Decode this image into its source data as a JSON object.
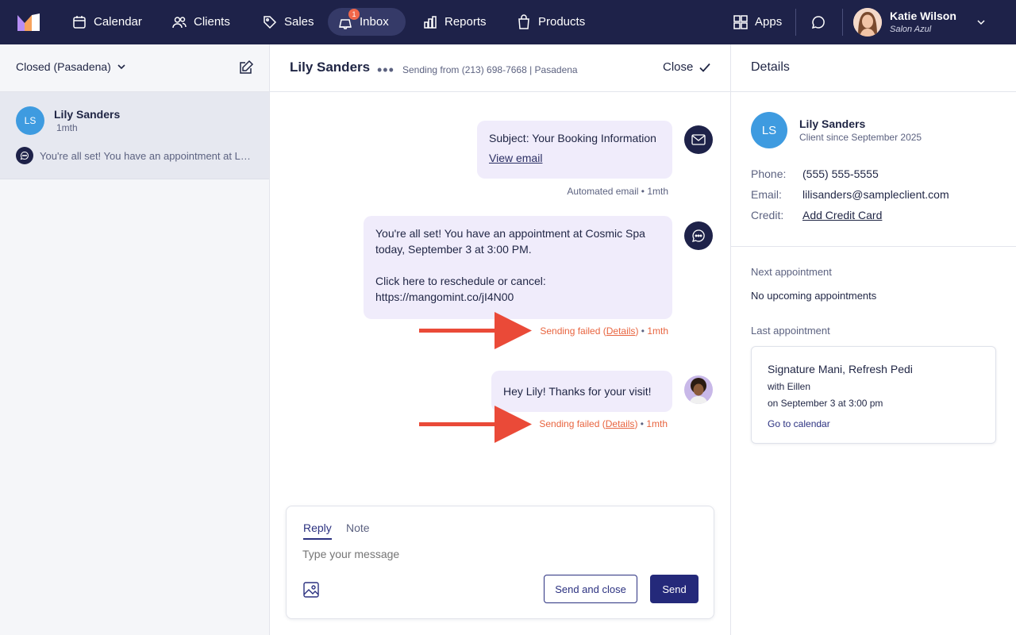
{
  "topnav": {
    "items": [
      {
        "label": "Calendar",
        "icon": "calendar-icon"
      },
      {
        "label": "Clients",
        "icon": "users-icon"
      },
      {
        "label": "Sales",
        "icon": "tag-icon"
      },
      {
        "label": "Inbox",
        "icon": "inbox-icon",
        "badge": "1",
        "active": true
      },
      {
        "label": "Reports",
        "icon": "bar-chart-icon"
      },
      {
        "label": "Products",
        "icon": "shopping-bag-icon"
      }
    ],
    "apps_label": "Apps",
    "user": {
      "name": "Katie Wilson",
      "location": "Salon Azul"
    }
  },
  "left_panel": {
    "filter_label": "Closed (Pasadena)",
    "conversations": [
      {
        "initials": "LS",
        "name": "Lily Sanders",
        "time": "1mth",
        "preview": "You're all set! You have an appointment at Lumiere..."
      }
    ]
  },
  "conversation": {
    "title": "Lily Sanders",
    "sending_from": "Sending from (213) 698-7668 | Pasadena",
    "close_label": "Close",
    "messages": [
      {
        "type": "email",
        "subject": "Subject: Your Booking Information",
        "link": "View email",
        "meta_source": "Automated email",
        "meta_time": "1mth"
      },
      {
        "type": "sms",
        "line1": "You're all set! You have an appointment at Cosmic Spa",
        "line2": "today, September 3 at 3:00 PM.",
        "line3": "Click here to reschedule or cancel:",
        "line4": "https://mangomint.co/jI4N00",
        "status": "Sending failed",
        "details": "Details",
        "meta_time": "1mth"
      },
      {
        "type": "staff",
        "text": "Hey Lily! Thanks for your visit!",
        "status": "Sending failed",
        "details": "Details",
        "meta_time": "1mth"
      }
    ],
    "composer": {
      "tab_reply": "Reply",
      "tab_note": "Note",
      "placeholder": "Type your message",
      "send_close_label": "Send and close",
      "send_label": "Send"
    }
  },
  "details": {
    "title": "Details",
    "client": {
      "initials": "LS",
      "name": "Lily Sanders",
      "since": "Client since September 2025"
    },
    "fields": {
      "phone_label": "Phone:",
      "phone": "(555) 555-5555",
      "email_label": "Email:",
      "email": "lilisanders@sampleclient.com",
      "credit_label": "Credit:",
      "credit_link": "Add Credit Card"
    },
    "next_label": "Next appointment",
    "next_text": "No upcoming appointments",
    "last_label": "Last appointment",
    "last_appt": {
      "title": "Signature Mani, Refresh Pedi",
      "with": "with Eillen",
      "when": "on September 3 at 3:00 pm",
      "link": "Go to calendar"
    }
  },
  "colors": {
    "nav_bg": "#1e2249",
    "accent": "#24297a",
    "error": "#e8643f",
    "bubble_bg": "#f0ecfb",
    "avatar_blue": "#3e9be0"
  }
}
